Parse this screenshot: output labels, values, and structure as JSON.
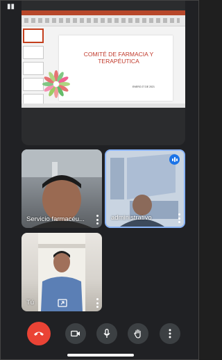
{
  "status_bar": {
    "icon": "signal-icon"
  },
  "shared_screen": {
    "slide_title_line1": "COMITÉ DE FARMACIA Y",
    "slide_title_line2": "TERAPÉUTICA",
    "slide_subtitle": "ENERO 27 DE 2021",
    "accent_color": "#b7472a",
    "fullscreen_icon": "fullscreen-icon"
  },
  "participants": [
    {
      "name": "Servicio farmacéu...",
      "speaking": false
    },
    {
      "name": "administrativo",
      "speaking": true
    },
    {
      "name": "Tú",
      "presenting": true
    }
  ],
  "controls": {
    "hangup_icon": "phone-hangup-icon",
    "camera_icon": "camera-icon",
    "mic_icon": "microphone-icon",
    "hand_icon": "raise-hand-icon",
    "more_icon": "more-vert-icon",
    "hangup_color": "#ea4335"
  }
}
